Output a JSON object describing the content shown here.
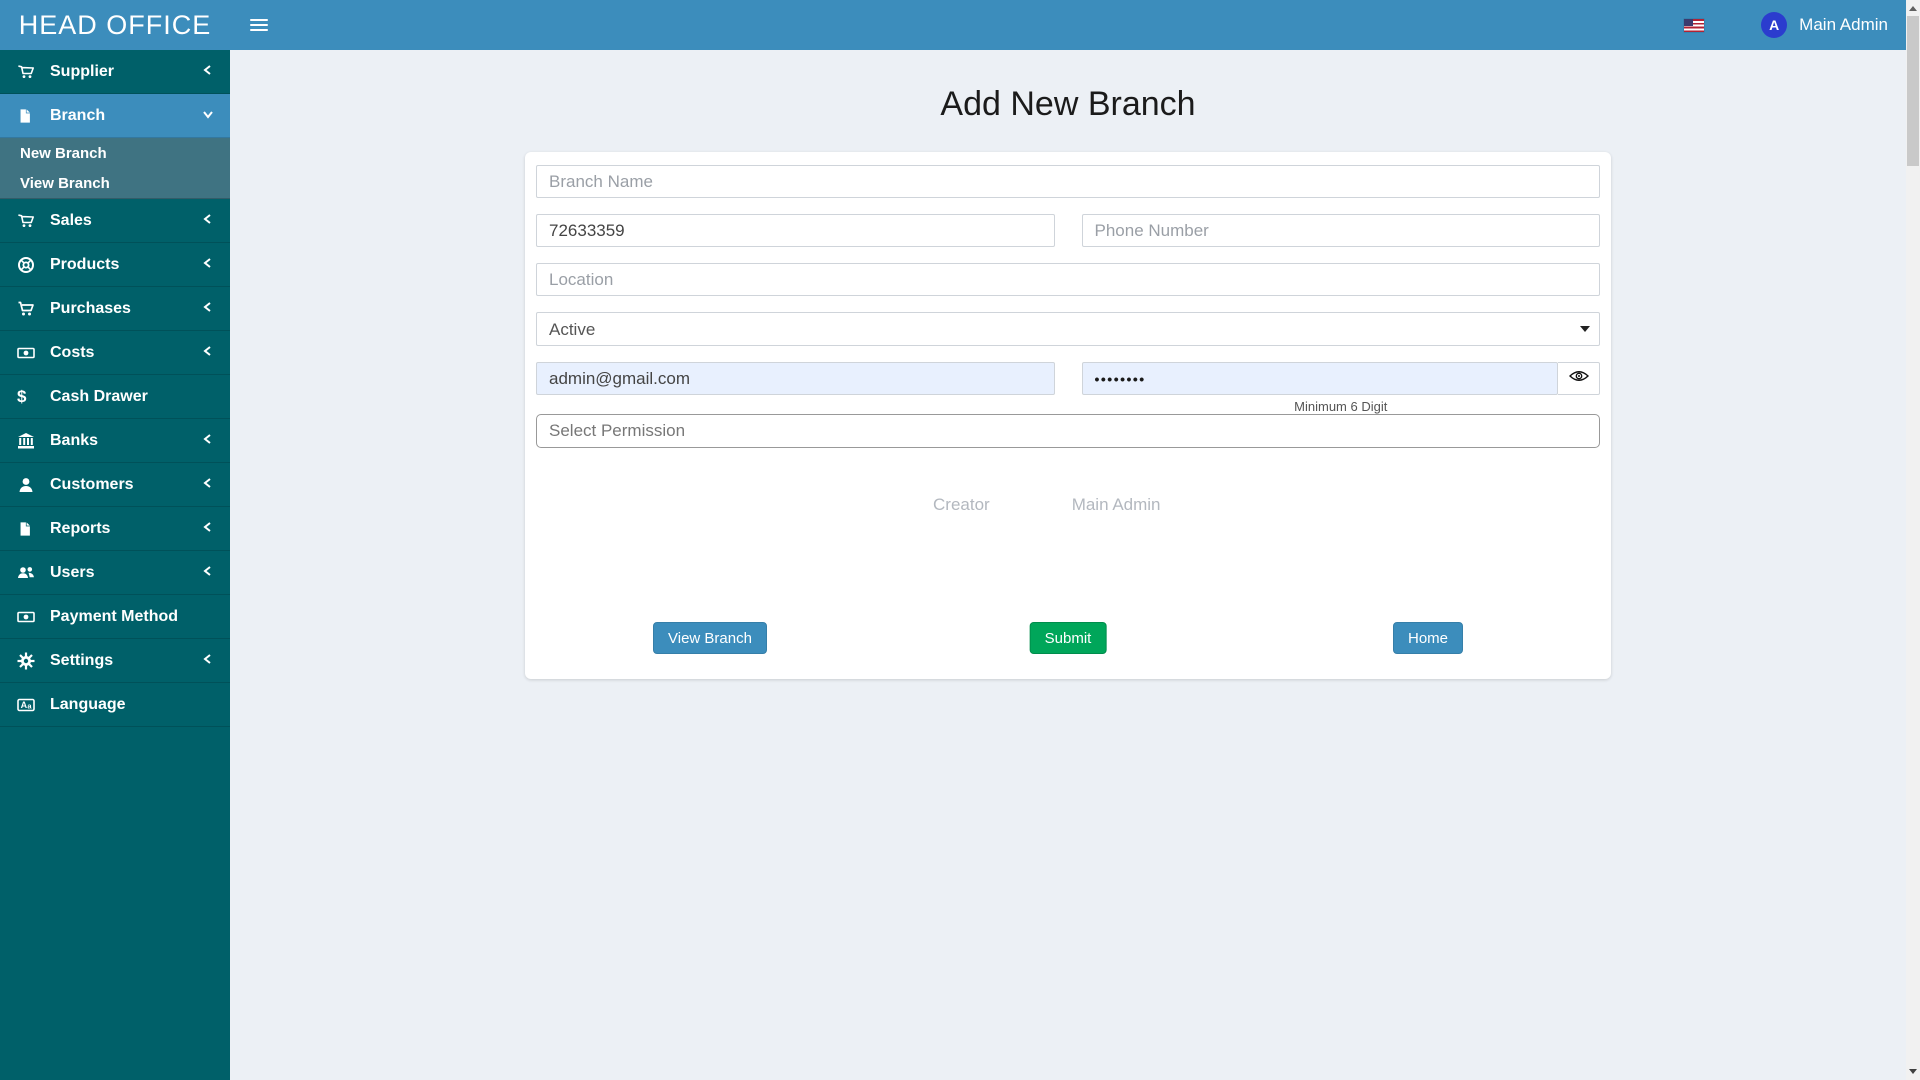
{
  "colors": {
    "header_blue": "#3c8dbc",
    "sidebar_teal": "#006069",
    "submenu_teal": "#3f7382",
    "content_bg": "#ecf0f5",
    "submit_green": "#00a65a",
    "autofill_bg": "#e8f0fe",
    "avatar_blue": "#2b3cce"
  },
  "brand": {
    "title": "HEAD OFFICE"
  },
  "header": {
    "hamburger_icon": "menu-icon",
    "flag_icon": "us-flag-icon",
    "user_name": "Main Admin",
    "avatar_letter": "A"
  },
  "sidebar": {
    "items": [
      {
        "label": "Supplier",
        "icon": "cart-icon",
        "chevron": "left"
      },
      {
        "label": "Branch",
        "icon": "file-icon",
        "chevron": "down",
        "active": true,
        "children": [
          {
            "label": "New Branch"
          },
          {
            "label": "View Branch"
          }
        ]
      },
      {
        "label": "Sales",
        "icon": "cart-icon",
        "chevron": "left"
      },
      {
        "label": "Products",
        "icon": "lifering-icon",
        "chevron": "left"
      },
      {
        "label": "Purchases",
        "icon": "shopping-cart-icon",
        "chevron": "left"
      },
      {
        "label": "Costs",
        "icon": "money-icon",
        "chevron": "left"
      },
      {
        "label": "Cash Drawer",
        "icon": "dollar-icon",
        "chevron": "none"
      },
      {
        "label": "Banks",
        "icon": "bank-icon",
        "chevron": "left"
      },
      {
        "label": "Customers",
        "icon": "user-icon",
        "chevron": "left"
      },
      {
        "label": "Reports",
        "icon": "file-icon",
        "chevron": "left"
      },
      {
        "label": "Users",
        "icon": "users-icon",
        "chevron": "left"
      },
      {
        "label": "Payment Method",
        "icon": "money-icon",
        "chevron": "none"
      },
      {
        "label": "Settings",
        "icon": "gear-icon",
        "chevron": "left"
      },
      {
        "label": "Language",
        "icon": "language-icon",
        "chevron": "none"
      }
    ]
  },
  "main": {
    "title": "Add New Branch",
    "form": {
      "branch_name_placeholder": "Branch Name",
      "branch_code_value": "72633359",
      "phone_placeholder": "Phone Number",
      "location_placeholder": "Location",
      "status_value": "Active",
      "email_value": "admin@gmail.com",
      "password_value": "••••••••",
      "password_hint": "Minimum 6 Digit",
      "password_eye_icon": "eye-icon",
      "permission_placeholder": "Select Permission",
      "creator_label": "Creator",
      "creator_value": "Main Admin",
      "buttons": {
        "view_branch": "View Branch",
        "submit": "Submit",
        "home": "Home"
      }
    }
  }
}
